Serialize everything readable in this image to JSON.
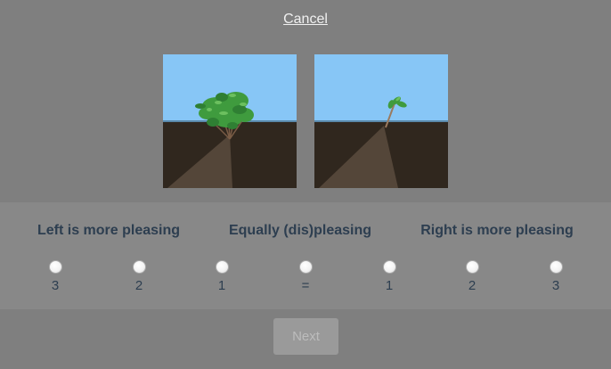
{
  "cancel_label": "Cancel",
  "rating": {
    "left_label": "Left is more pleasing",
    "middle_label": "Equally (dis)pleasing",
    "right_label": "Right is more pleasing",
    "options": [
      "3",
      "2",
      "1",
      "=",
      "1",
      "2",
      "3"
    ]
  },
  "next_label": "Next",
  "colors": {
    "background": "#7f7f7f",
    "panel": "#888888",
    "label_text": "#2d3e50",
    "sky": "#87c6f6",
    "soil": "#30271e",
    "disabled_button": "#9a9a9a"
  }
}
